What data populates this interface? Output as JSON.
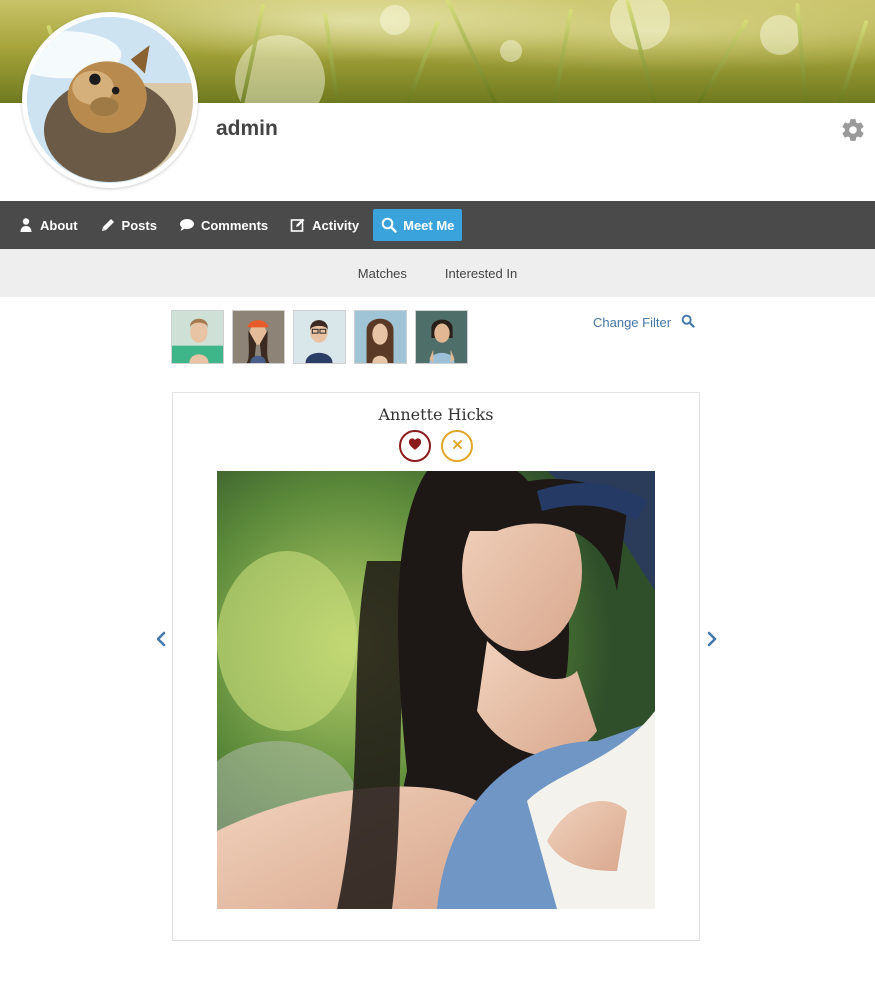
{
  "profile": {
    "username": "admin"
  },
  "nav": {
    "items": [
      {
        "label": "About",
        "icon": "user-icon"
      },
      {
        "label": "Posts",
        "icon": "pencil-icon"
      },
      {
        "label": "Comments",
        "icon": "comment-icon"
      },
      {
        "label": "Activity",
        "icon": "edit-icon"
      },
      {
        "label": "Meet Me",
        "icon": "search-icon",
        "active": true
      }
    ]
  },
  "subnav": {
    "items": [
      "Matches",
      "Interested In"
    ]
  },
  "filter": {
    "label": "Change Filter",
    "icon": "search-icon"
  },
  "card": {
    "name": "Annette Hicks",
    "like_icon": "heart-icon",
    "skip_icon": "close-icon"
  },
  "colors": {
    "nav_bg": "#4a4a4a",
    "accent": "#3aa3dc",
    "link": "#4477aa",
    "like": "#8b1a1a",
    "skip": "#e3a727",
    "subnav_bg": "#eeeeee"
  }
}
